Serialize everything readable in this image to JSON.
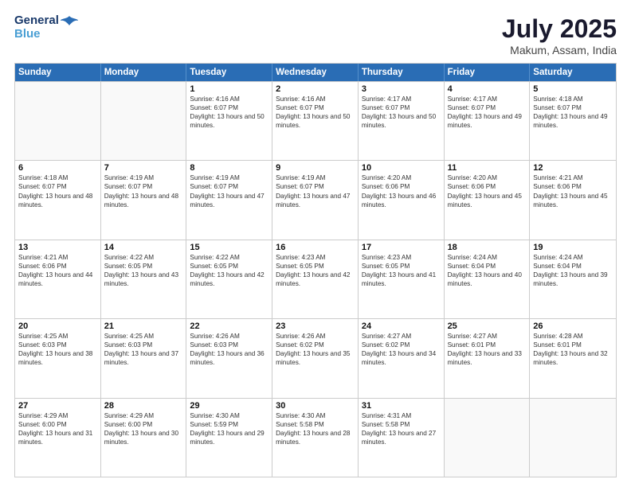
{
  "header": {
    "logo_line1": "General",
    "logo_line2": "Blue",
    "month_year": "July 2025",
    "location": "Makum, Assam, India"
  },
  "weekdays": [
    "Sunday",
    "Monday",
    "Tuesday",
    "Wednesday",
    "Thursday",
    "Friday",
    "Saturday"
  ],
  "rows": [
    [
      {
        "day": "",
        "sunrise": "",
        "sunset": "",
        "daylight": ""
      },
      {
        "day": "",
        "sunrise": "",
        "sunset": "",
        "daylight": ""
      },
      {
        "day": "1",
        "sunrise": "Sunrise: 4:16 AM",
        "sunset": "Sunset: 6:07 PM",
        "daylight": "Daylight: 13 hours and 50 minutes."
      },
      {
        "day": "2",
        "sunrise": "Sunrise: 4:16 AM",
        "sunset": "Sunset: 6:07 PM",
        "daylight": "Daylight: 13 hours and 50 minutes."
      },
      {
        "day": "3",
        "sunrise": "Sunrise: 4:17 AM",
        "sunset": "Sunset: 6:07 PM",
        "daylight": "Daylight: 13 hours and 50 minutes."
      },
      {
        "day": "4",
        "sunrise": "Sunrise: 4:17 AM",
        "sunset": "Sunset: 6:07 PM",
        "daylight": "Daylight: 13 hours and 49 minutes."
      },
      {
        "day": "5",
        "sunrise": "Sunrise: 4:18 AM",
        "sunset": "Sunset: 6:07 PM",
        "daylight": "Daylight: 13 hours and 49 minutes."
      }
    ],
    [
      {
        "day": "6",
        "sunrise": "Sunrise: 4:18 AM",
        "sunset": "Sunset: 6:07 PM",
        "daylight": "Daylight: 13 hours and 48 minutes."
      },
      {
        "day": "7",
        "sunrise": "Sunrise: 4:19 AM",
        "sunset": "Sunset: 6:07 PM",
        "daylight": "Daylight: 13 hours and 48 minutes."
      },
      {
        "day": "8",
        "sunrise": "Sunrise: 4:19 AM",
        "sunset": "Sunset: 6:07 PM",
        "daylight": "Daylight: 13 hours and 47 minutes."
      },
      {
        "day": "9",
        "sunrise": "Sunrise: 4:19 AM",
        "sunset": "Sunset: 6:07 PM",
        "daylight": "Daylight: 13 hours and 47 minutes."
      },
      {
        "day": "10",
        "sunrise": "Sunrise: 4:20 AM",
        "sunset": "Sunset: 6:06 PM",
        "daylight": "Daylight: 13 hours and 46 minutes."
      },
      {
        "day": "11",
        "sunrise": "Sunrise: 4:20 AM",
        "sunset": "Sunset: 6:06 PM",
        "daylight": "Daylight: 13 hours and 45 minutes."
      },
      {
        "day": "12",
        "sunrise": "Sunrise: 4:21 AM",
        "sunset": "Sunset: 6:06 PM",
        "daylight": "Daylight: 13 hours and 45 minutes."
      }
    ],
    [
      {
        "day": "13",
        "sunrise": "Sunrise: 4:21 AM",
        "sunset": "Sunset: 6:06 PM",
        "daylight": "Daylight: 13 hours and 44 minutes."
      },
      {
        "day": "14",
        "sunrise": "Sunrise: 4:22 AM",
        "sunset": "Sunset: 6:05 PM",
        "daylight": "Daylight: 13 hours and 43 minutes."
      },
      {
        "day": "15",
        "sunrise": "Sunrise: 4:22 AM",
        "sunset": "Sunset: 6:05 PM",
        "daylight": "Daylight: 13 hours and 42 minutes."
      },
      {
        "day": "16",
        "sunrise": "Sunrise: 4:23 AM",
        "sunset": "Sunset: 6:05 PM",
        "daylight": "Daylight: 13 hours and 42 minutes."
      },
      {
        "day": "17",
        "sunrise": "Sunrise: 4:23 AM",
        "sunset": "Sunset: 6:05 PM",
        "daylight": "Daylight: 13 hours and 41 minutes."
      },
      {
        "day": "18",
        "sunrise": "Sunrise: 4:24 AM",
        "sunset": "Sunset: 6:04 PM",
        "daylight": "Daylight: 13 hours and 40 minutes."
      },
      {
        "day": "19",
        "sunrise": "Sunrise: 4:24 AM",
        "sunset": "Sunset: 6:04 PM",
        "daylight": "Daylight: 13 hours and 39 minutes."
      }
    ],
    [
      {
        "day": "20",
        "sunrise": "Sunrise: 4:25 AM",
        "sunset": "Sunset: 6:03 PM",
        "daylight": "Daylight: 13 hours and 38 minutes."
      },
      {
        "day": "21",
        "sunrise": "Sunrise: 4:25 AM",
        "sunset": "Sunset: 6:03 PM",
        "daylight": "Daylight: 13 hours and 37 minutes."
      },
      {
        "day": "22",
        "sunrise": "Sunrise: 4:26 AM",
        "sunset": "Sunset: 6:03 PM",
        "daylight": "Daylight: 13 hours and 36 minutes."
      },
      {
        "day": "23",
        "sunrise": "Sunrise: 4:26 AM",
        "sunset": "Sunset: 6:02 PM",
        "daylight": "Daylight: 13 hours and 35 minutes."
      },
      {
        "day": "24",
        "sunrise": "Sunrise: 4:27 AM",
        "sunset": "Sunset: 6:02 PM",
        "daylight": "Daylight: 13 hours and 34 minutes."
      },
      {
        "day": "25",
        "sunrise": "Sunrise: 4:27 AM",
        "sunset": "Sunset: 6:01 PM",
        "daylight": "Daylight: 13 hours and 33 minutes."
      },
      {
        "day": "26",
        "sunrise": "Sunrise: 4:28 AM",
        "sunset": "Sunset: 6:01 PM",
        "daylight": "Daylight: 13 hours and 32 minutes."
      }
    ],
    [
      {
        "day": "27",
        "sunrise": "Sunrise: 4:29 AM",
        "sunset": "Sunset: 6:00 PM",
        "daylight": "Daylight: 13 hours and 31 minutes."
      },
      {
        "day": "28",
        "sunrise": "Sunrise: 4:29 AM",
        "sunset": "Sunset: 6:00 PM",
        "daylight": "Daylight: 13 hours and 30 minutes."
      },
      {
        "day": "29",
        "sunrise": "Sunrise: 4:30 AM",
        "sunset": "Sunset: 5:59 PM",
        "daylight": "Daylight: 13 hours and 29 minutes."
      },
      {
        "day": "30",
        "sunrise": "Sunrise: 4:30 AM",
        "sunset": "Sunset: 5:58 PM",
        "daylight": "Daylight: 13 hours and 28 minutes."
      },
      {
        "day": "31",
        "sunrise": "Sunrise: 4:31 AM",
        "sunset": "Sunset: 5:58 PM",
        "daylight": "Daylight: 13 hours and 27 minutes."
      },
      {
        "day": "",
        "sunrise": "",
        "sunset": "",
        "daylight": ""
      },
      {
        "day": "",
        "sunrise": "",
        "sunset": "",
        "daylight": ""
      }
    ]
  ]
}
